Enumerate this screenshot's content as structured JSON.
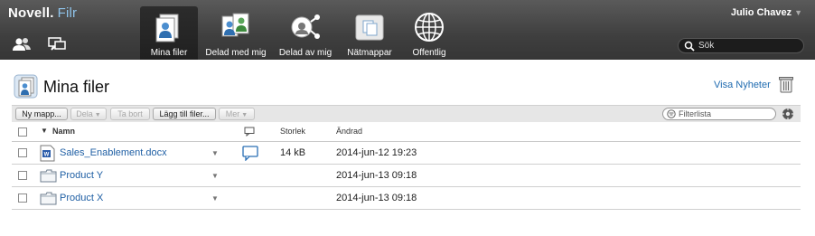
{
  "app": {
    "brand_main": "Novell.",
    "brand_sub": "Filr"
  },
  "user": {
    "name": "Julio Chavez"
  },
  "nav": [
    {
      "label": "Mina filer",
      "active": true
    },
    {
      "label": "Delad med mig",
      "active": false
    },
    {
      "label": "Delad av mig",
      "active": false
    },
    {
      "label": "Nätmappar",
      "active": false
    },
    {
      "label": "Offentlig",
      "active": false
    }
  ],
  "search": {
    "placeholder": "Sök"
  },
  "page": {
    "title": "Mina filer",
    "news_link": "Visa Nyheter"
  },
  "toolbar": {
    "new_folder": "Ny mapp...",
    "share": "Dela",
    "delete": "Ta bort",
    "add_files": "Lägg till filer...",
    "more": "Mer",
    "filter_placeholder": "Filterlista"
  },
  "table": {
    "columns": {
      "name": "Namn",
      "size": "Storlek",
      "modified": "Ändrad"
    },
    "rows": [
      {
        "name": "Sales_Enablement.docx",
        "type": "docx",
        "size": "14 kB",
        "modified": "2014-jun-12 19:23",
        "has_comment": true
      },
      {
        "name": "Product Y",
        "type": "folder",
        "size": "",
        "modified": "2014-jun-13 09:18",
        "has_comment": false
      },
      {
        "name": "Product X",
        "type": "folder",
        "size": "",
        "modified": "2014-jun-13 09:18",
        "has_comment": false
      }
    ]
  },
  "colors": {
    "topbar": "#3f3f3f",
    "link": "#1f5fa4",
    "brand_accent": "#8fc3ea"
  },
  "icons": {
    "nav": [
      "my-files-icon",
      "shared-with-me-icon",
      "shared-by-me-icon",
      "net-folders-icon",
      "public-icon"
    ],
    "left": [
      "people-icon",
      "comments-icon"
    ]
  }
}
